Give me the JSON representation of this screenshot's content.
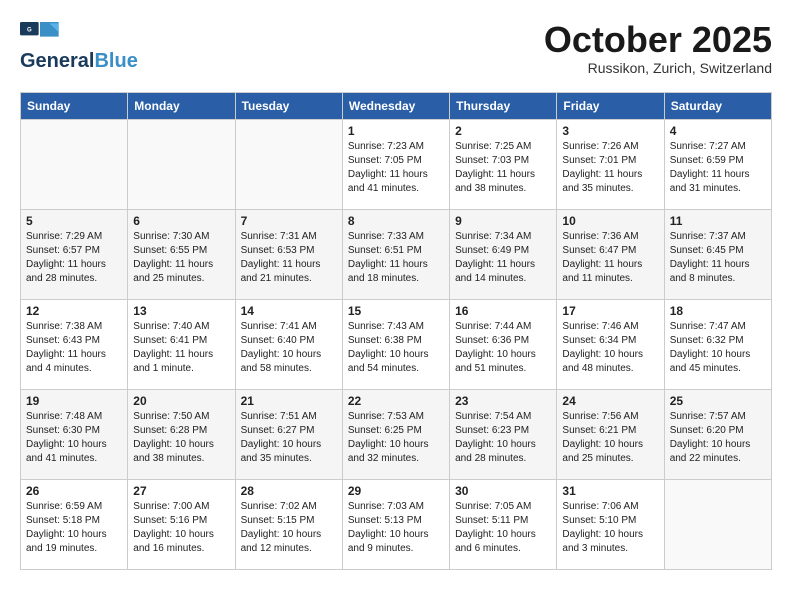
{
  "logo": {
    "line1": "General",
    "line2": "Blue",
    "tagline": ""
  },
  "header": {
    "month": "October 2025",
    "location": "Russikon, Zurich, Switzerland"
  },
  "days_of_week": [
    "Sunday",
    "Monday",
    "Tuesday",
    "Wednesday",
    "Thursday",
    "Friday",
    "Saturday"
  ],
  "weeks": [
    [
      {
        "day": "",
        "info": ""
      },
      {
        "day": "",
        "info": ""
      },
      {
        "day": "",
        "info": ""
      },
      {
        "day": "1",
        "info": "Sunrise: 7:23 AM\nSunset: 7:05 PM\nDaylight: 11 hours\nand 41 minutes."
      },
      {
        "day": "2",
        "info": "Sunrise: 7:25 AM\nSunset: 7:03 PM\nDaylight: 11 hours\nand 38 minutes."
      },
      {
        "day": "3",
        "info": "Sunrise: 7:26 AM\nSunset: 7:01 PM\nDaylight: 11 hours\nand 35 minutes."
      },
      {
        "day": "4",
        "info": "Sunrise: 7:27 AM\nSunset: 6:59 PM\nDaylight: 11 hours\nand 31 minutes."
      }
    ],
    [
      {
        "day": "5",
        "info": "Sunrise: 7:29 AM\nSunset: 6:57 PM\nDaylight: 11 hours\nand 28 minutes."
      },
      {
        "day": "6",
        "info": "Sunrise: 7:30 AM\nSunset: 6:55 PM\nDaylight: 11 hours\nand 25 minutes."
      },
      {
        "day": "7",
        "info": "Sunrise: 7:31 AM\nSunset: 6:53 PM\nDaylight: 11 hours\nand 21 minutes."
      },
      {
        "day": "8",
        "info": "Sunrise: 7:33 AM\nSunset: 6:51 PM\nDaylight: 11 hours\nand 18 minutes."
      },
      {
        "day": "9",
        "info": "Sunrise: 7:34 AM\nSunset: 6:49 PM\nDaylight: 11 hours\nand 14 minutes."
      },
      {
        "day": "10",
        "info": "Sunrise: 7:36 AM\nSunset: 6:47 PM\nDaylight: 11 hours\nand 11 minutes."
      },
      {
        "day": "11",
        "info": "Sunrise: 7:37 AM\nSunset: 6:45 PM\nDaylight: 11 hours\nand 8 minutes."
      }
    ],
    [
      {
        "day": "12",
        "info": "Sunrise: 7:38 AM\nSunset: 6:43 PM\nDaylight: 11 hours\nand 4 minutes."
      },
      {
        "day": "13",
        "info": "Sunrise: 7:40 AM\nSunset: 6:41 PM\nDaylight: 11 hours\nand 1 minute."
      },
      {
        "day": "14",
        "info": "Sunrise: 7:41 AM\nSunset: 6:40 PM\nDaylight: 10 hours\nand 58 minutes."
      },
      {
        "day": "15",
        "info": "Sunrise: 7:43 AM\nSunset: 6:38 PM\nDaylight: 10 hours\nand 54 minutes."
      },
      {
        "day": "16",
        "info": "Sunrise: 7:44 AM\nSunset: 6:36 PM\nDaylight: 10 hours\nand 51 minutes."
      },
      {
        "day": "17",
        "info": "Sunrise: 7:46 AM\nSunset: 6:34 PM\nDaylight: 10 hours\nand 48 minutes."
      },
      {
        "day": "18",
        "info": "Sunrise: 7:47 AM\nSunset: 6:32 PM\nDaylight: 10 hours\nand 45 minutes."
      }
    ],
    [
      {
        "day": "19",
        "info": "Sunrise: 7:48 AM\nSunset: 6:30 PM\nDaylight: 10 hours\nand 41 minutes."
      },
      {
        "day": "20",
        "info": "Sunrise: 7:50 AM\nSunset: 6:28 PM\nDaylight: 10 hours\nand 38 minutes."
      },
      {
        "day": "21",
        "info": "Sunrise: 7:51 AM\nSunset: 6:27 PM\nDaylight: 10 hours\nand 35 minutes."
      },
      {
        "day": "22",
        "info": "Sunrise: 7:53 AM\nSunset: 6:25 PM\nDaylight: 10 hours\nand 32 minutes."
      },
      {
        "day": "23",
        "info": "Sunrise: 7:54 AM\nSunset: 6:23 PM\nDaylight: 10 hours\nand 28 minutes."
      },
      {
        "day": "24",
        "info": "Sunrise: 7:56 AM\nSunset: 6:21 PM\nDaylight: 10 hours\nand 25 minutes."
      },
      {
        "day": "25",
        "info": "Sunrise: 7:57 AM\nSunset: 6:20 PM\nDaylight: 10 hours\nand 22 minutes."
      }
    ],
    [
      {
        "day": "26",
        "info": "Sunrise: 6:59 AM\nSunset: 5:18 PM\nDaylight: 10 hours\nand 19 minutes."
      },
      {
        "day": "27",
        "info": "Sunrise: 7:00 AM\nSunset: 5:16 PM\nDaylight: 10 hours\nand 16 minutes."
      },
      {
        "day": "28",
        "info": "Sunrise: 7:02 AM\nSunset: 5:15 PM\nDaylight: 10 hours\nand 12 minutes."
      },
      {
        "day": "29",
        "info": "Sunrise: 7:03 AM\nSunset: 5:13 PM\nDaylight: 10 hours\nand 9 minutes."
      },
      {
        "day": "30",
        "info": "Sunrise: 7:05 AM\nSunset: 5:11 PM\nDaylight: 10 hours\nand 6 minutes."
      },
      {
        "day": "31",
        "info": "Sunrise: 7:06 AM\nSunset: 5:10 PM\nDaylight: 10 hours\nand 3 minutes."
      },
      {
        "day": "",
        "info": ""
      }
    ]
  ]
}
